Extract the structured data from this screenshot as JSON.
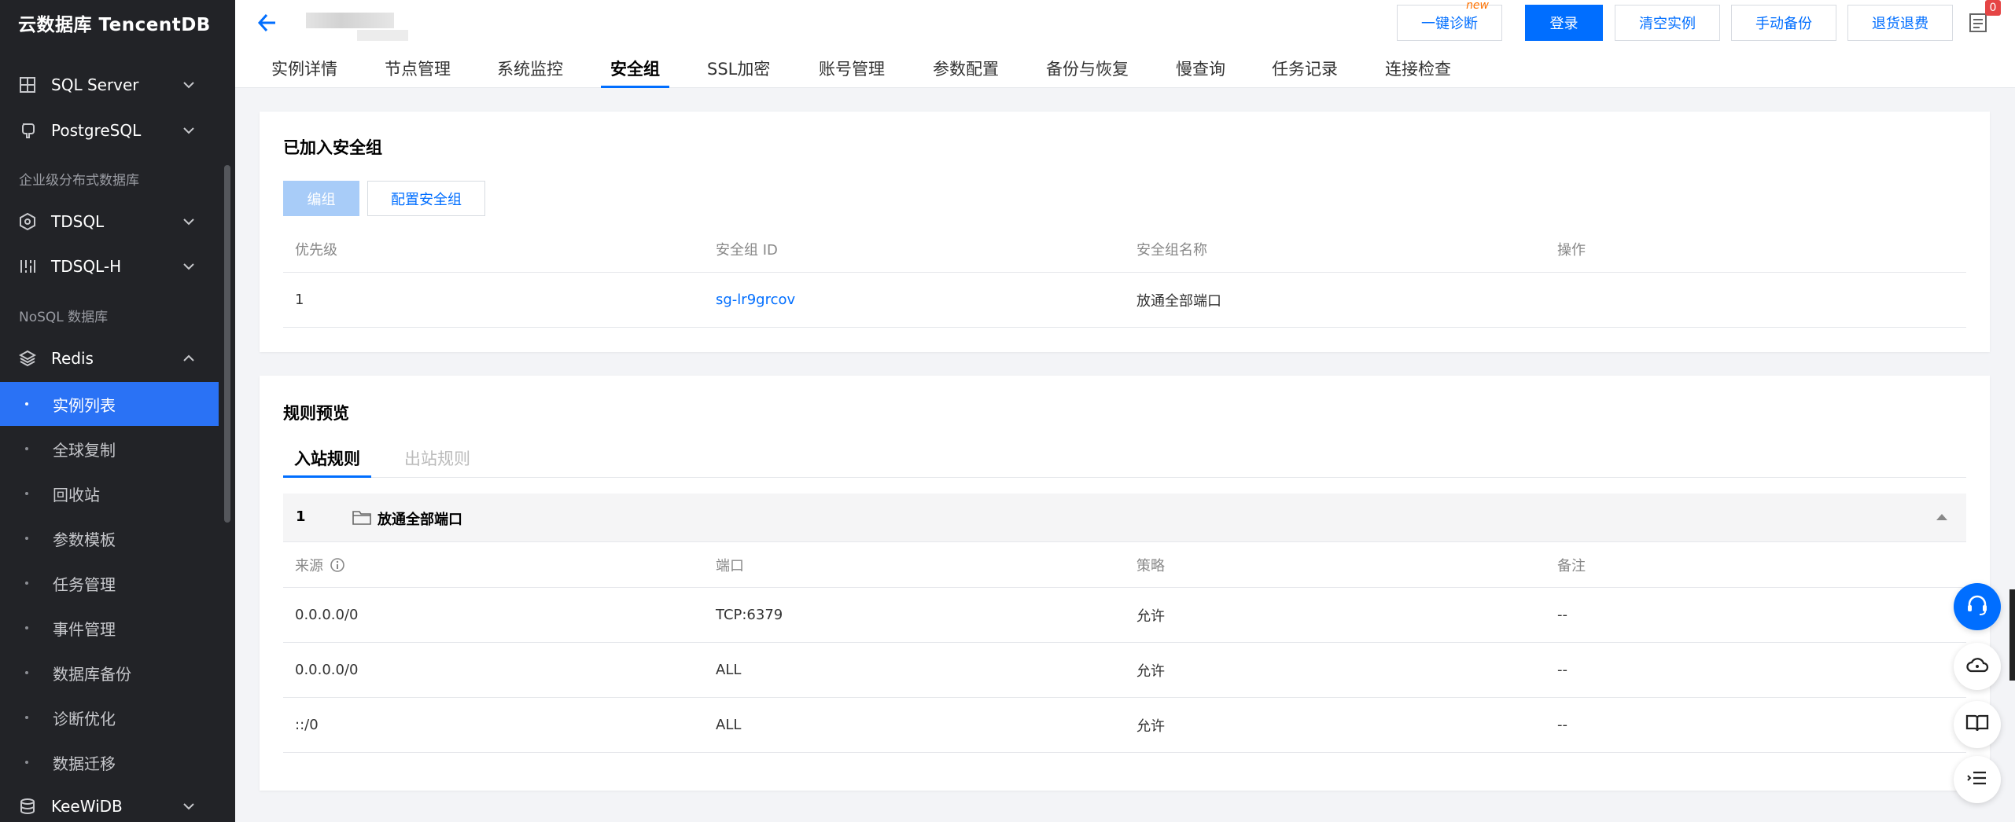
{
  "brand": "云数据库 TencentDB",
  "sidebar": {
    "items": [
      {
        "label": "SQL Server",
        "icon": "grid-icon",
        "chevron": "down"
      },
      {
        "label": "PostgreSQL",
        "icon": "elephant-icon",
        "chevron": "down"
      },
      {
        "label": "TDSQL",
        "icon": "hexagon-icon",
        "chevron": "down"
      },
      {
        "label": "TDSQL-H",
        "icon": "bars-icon",
        "chevron": "down"
      },
      {
        "label": "Redis",
        "icon": "layers-icon",
        "chevron": "up"
      },
      {
        "label": "KeeWiDB",
        "icon": "database-icon",
        "chevron": "down"
      }
    ],
    "sections": [
      "企业级分布式数据库",
      "NoSQL 数据库"
    ],
    "sub_items": [
      "实例列表",
      "全球复制",
      "回收站",
      "参数模板",
      "任务管理",
      "事件管理",
      "数据库备份",
      "诊断优化",
      "数据迁移"
    ],
    "active_sub": "实例列表"
  },
  "header": {
    "buttons": [
      "一键诊断",
      "登录",
      "清空实例",
      "手动备份",
      "退货退费"
    ],
    "new_badge": "new",
    "notification_count": "0"
  },
  "tabs": [
    "实例详情",
    "节点管理",
    "系统监控",
    "安全组",
    "SSL加密",
    "账号管理",
    "参数配置",
    "备份与恢复",
    "慢查询",
    "任务记录",
    "连接检查"
  ],
  "active_tab": "安全组",
  "security_group": {
    "title": "已加入安全组",
    "edit_button": "编组",
    "config_button": "配置安全组",
    "columns": [
      "优先级",
      "安全组 ID",
      "安全组名称",
      "操作"
    ],
    "rows": [
      {
        "priority": "1",
        "id": "sg-lr9grcov",
        "name": "放通全部端口",
        "action": ""
      }
    ]
  },
  "rules": {
    "title": "规则预览",
    "tabs": [
      "入站规则",
      "出站规则"
    ],
    "active_tab": "入站规则",
    "group": {
      "num": "1",
      "name": "放通全部端口"
    },
    "columns": [
      "来源",
      "端口",
      "策略",
      "备注"
    ],
    "rows": [
      {
        "source": "0.0.0.0/0",
        "port": "TCP:6379",
        "policy": "允许",
        "note": "--"
      },
      {
        "source": "0.0.0.0/0",
        "port": "ALL",
        "policy": "允许",
        "note": "--"
      },
      {
        "source": "::/0",
        "port": "ALL",
        "policy": "允许",
        "note": "--"
      }
    ]
  },
  "colors": {
    "primary": "#006eff",
    "sidebar_bg": "#222327",
    "active_item": "#2a72f5"
  }
}
